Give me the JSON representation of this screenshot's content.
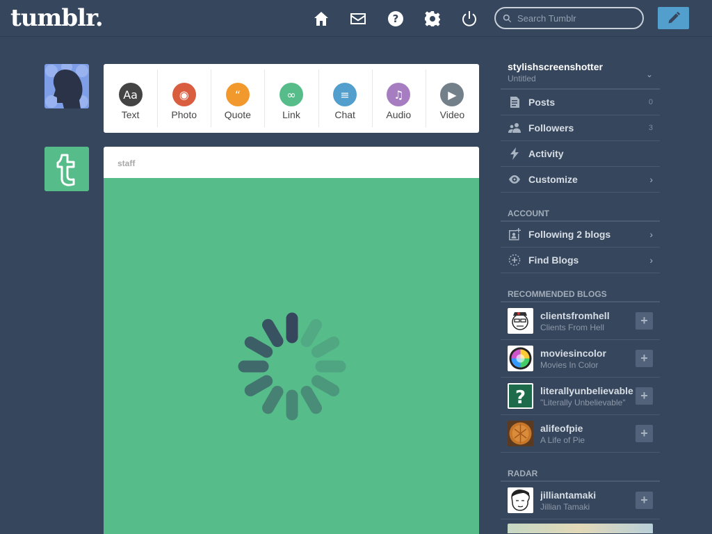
{
  "header": {
    "logo": "tumblr.",
    "search_placeholder": "Search Tumblr",
    "icons": [
      "home-icon",
      "mail-icon",
      "help-icon",
      "gear-icon",
      "power-icon"
    ],
    "accent": "#529ecc"
  },
  "post_types": [
    {
      "label": "Text",
      "color": "#444444",
      "glyph": "Aa"
    },
    {
      "label": "Photo",
      "color": "#d95e40",
      "glyph": "◉"
    },
    {
      "label": "Quote",
      "color": "#f2992e",
      "glyph": "“"
    },
    {
      "label": "Link",
      "color": "#56bc8a",
      "glyph": "∞"
    },
    {
      "label": "Chat",
      "color": "#529ecc",
      "glyph": "≡"
    },
    {
      "label": "Audio",
      "color": "#a77dc2",
      "glyph": "♫"
    },
    {
      "label": "Video",
      "color": "#748089",
      "glyph": "▶"
    }
  ],
  "post": {
    "author": "staff",
    "body_color": "#56bc8a"
  },
  "sidebar": {
    "blog_name": "stylishscreenshotter",
    "blog_subtitle": "Untitled",
    "items": [
      {
        "label": "Posts",
        "count": "0",
        "icon": "posts-icon"
      },
      {
        "label": "Followers",
        "count": "3",
        "icon": "followers-icon"
      },
      {
        "label": "Activity",
        "icon": "activity-icon"
      },
      {
        "label": "Customize",
        "icon": "eye-icon"
      }
    ],
    "account_heading": "ACCOUNT",
    "account_items": [
      {
        "label": "Following 2 blogs",
        "icon": "following-icon"
      },
      {
        "label": "Find Blogs",
        "icon": "find-icon"
      }
    ],
    "recommended_heading": "RECOMMENDED BLOGS",
    "recommended": [
      {
        "name": "clientsfromhell",
        "desc": "Clients From Hell"
      },
      {
        "name": "moviesincolor",
        "desc": "Movies In Color"
      },
      {
        "name": "literallyunbelievable",
        "desc": "\"Literally Unbelievable\""
      },
      {
        "name": "alifeofpie",
        "desc": "A Life of Pie"
      }
    ],
    "radar_heading": "RADAR",
    "radar": [
      {
        "name": "jilliantamaki",
        "desc": "Jillian Tamaki"
      }
    ]
  }
}
